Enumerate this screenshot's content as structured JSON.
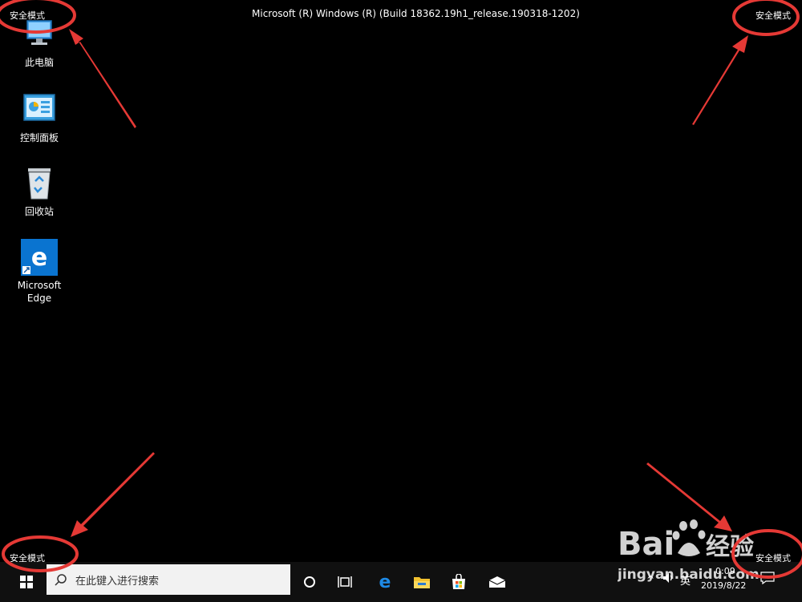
{
  "window_title": "Microsoft (R) Windows (R) (Build 18362.19h1_release.190318-1202)",
  "safe_mode_label": "安全模式",
  "desktop_icons": [
    {
      "label": "此电脑",
      "icon": "this-pc-icon"
    },
    {
      "label": "控制面板",
      "icon": "control-panel-icon"
    },
    {
      "label": "回收站",
      "icon": "recycle-bin-icon"
    },
    {
      "label": "Microsoft\nEdge",
      "icon": "edge-icon"
    }
  ],
  "taskbar": {
    "search_placeholder": "在此键入进行搜索",
    "pinned": [
      "cortana-icon",
      "task-view-icon",
      "edge-icon",
      "file-explorer-icon",
      "store-icon",
      "mail-icon"
    ],
    "tray": {
      "input_indicator": "英",
      "time": "0:09",
      "date": "2019/8/22"
    }
  },
  "watermark": {
    "brand": "Bai",
    "brand_cn": "经验",
    "url": "jingyan.baidu.com"
  },
  "colors": {
    "annotation_red": "#e53935",
    "background": "#000000",
    "taskbar": "#101010",
    "accent_blue": "#0078d7"
  }
}
